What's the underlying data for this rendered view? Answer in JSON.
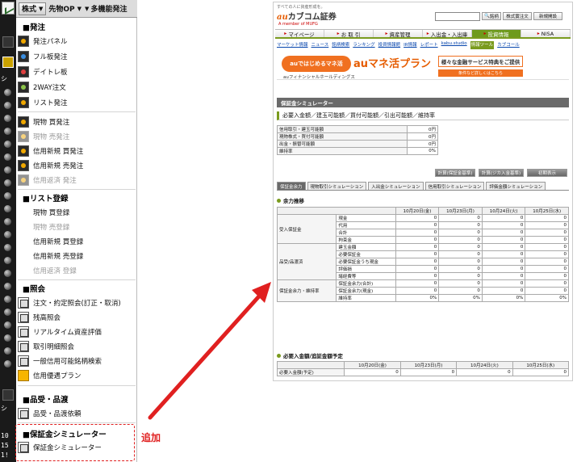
{
  "toolbar": {
    "stocks": "株式",
    "futures": "先物OP",
    "multi": "多機能発注"
  },
  "left_strip": {
    "label_a": "シ",
    "label_b": "シ",
    "num_a": "10",
    "num_b": "15",
    "num_c": "1!"
  },
  "menu": {
    "order_section": "■発注",
    "order_items": [
      "発注パネル",
      "フル板発注",
      "デイトレ板",
      "2WAY注文",
      "リスト発注"
    ],
    "trade_items": [
      {
        "label": "現物 買発注",
        "disabled": false
      },
      {
        "label": "現物 売発注",
        "disabled": true
      },
      {
        "label": "信用新規 買発注",
        "disabled": false
      },
      {
        "label": "信用新規 売発注",
        "disabled": false
      },
      {
        "label": "信用返済 発注",
        "disabled": true
      }
    ],
    "list_section": "■リスト登録",
    "list_items": [
      {
        "label": "現物 買登録",
        "disabled": false
      },
      {
        "label": "現物 売登録",
        "disabled": true
      },
      {
        "label": "信用新規 買登録",
        "disabled": false
      },
      {
        "label": "信用新規 売登録",
        "disabled": false
      },
      {
        "label": "信用返済 登録",
        "disabled": true
      }
    ],
    "inquiry_section": "■照会",
    "inquiry_items": [
      "注文・約定照会(訂正・取消)",
      "残高照会",
      "リアルタイム資産評価",
      "取引明細照会",
      "一般信用可能銘柄検索",
      "信用優遇プラン"
    ],
    "delivery_section": "■品受・品渡",
    "delivery_items": [
      "品受・品渡依頼"
    ],
    "sim_section": "■保証金シミュレーター",
    "sim_items": [
      "保証金シミュレーター"
    ]
  },
  "callout": {
    "label": "追加",
    "color": "#e02020"
  },
  "web": {
    "tagline": "すべての人に資産形成を。",
    "brand_au": "au",
    "brand_name": "カブコム証券",
    "brand_sub": "A member of MUFG",
    "btn_search": "銘柄",
    "btn_price": "株式實注文",
    "btn_new": "新規開設",
    "nav": [
      "マイページ",
      "お 取 引",
      "資産管理",
      "入出金・入出庫",
      "投資情報",
      "NISA"
    ],
    "nav_active": 4,
    "subnav": [
      "マーケット情報",
      "ニュース",
      "銘柄検索",
      "ランキング",
      "投資情報館",
      "IR情報",
      "レポート",
      "kabu.studio",
      "情報ツール",
      "カブコール"
    ],
    "subnav_active": 8,
    "banner": {
      "start": "auではじめるマネ活",
      "title": "auマネ活プラン",
      "offer": "様々な金融サービス特典をご提供",
      "cta": "条件など詳しくはこちら",
      "group": "auフィナンシャルホールディングス"
    },
    "page_title": "保証金シミュレーター",
    "caption": "必要入金額／建玉可能額／買付可能額／引出可能額／維持率",
    "summary": [
      {
        "label": "信用取引・建玉可能額",
        "value": "0円"
      },
      {
        "label": "現物株式・買付可能額",
        "value": "0円"
      },
      {
        "label": "出金・振替可能額",
        "value": "0円"
      },
      {
        "label": "維持率",
        "value": "0%"
      }
    ],
    "actions": [
      "計算(保証金基準)",
      "計算(ジカ入金基準)",
      "初期表示"
    ],
    "tabs": [
      "保証金余力",
      "現物取引シミュレーション",
      "入出金シミュレーション",
      "信用取引シミュレーション",
      "評価金額シミュレーション"
    ],
    "section1": "余力推移",
    "dates": [
      "10月20日(金)",
      "10月23日(月)",
      "10月24日(火)",
      "10月25日(水)"
    ],
    "groups": [
      {
        "name": "受入保証金",
        "rows": [
          "現金",
          "代用",
          "合計",
          "拘束金"
        ],
        "vals": [
          "0",
          "0",
          "0",
          "0"
        ]
      },
      {
        "name": "品受/品渡済",
        "rows": [
          "建玉金額",
          "必要保証金",
          "必要保証金うち現金",
          "評価損",
          "諸経費等"
        ],
        "vals": [
          "0",
          "0",
          "0",
          "0"
        ]
      },
      {
        "name": "保証金余力・維持率",
        "rows": [
          "保証金余力(合計)",
          "保証金余力(現金)",
          "維持率"
        ],
        "vals": [
          "0",
          "0",
          "0%",
          "0%"
        ]
      }
    ],
    "section2": "必要入金額/追証金額予定",
    "due_label": "必要入金額(予定)",
    "due_vals": [
      "0",
      "0",
      "0",
      "0"
    ]
  }
}
